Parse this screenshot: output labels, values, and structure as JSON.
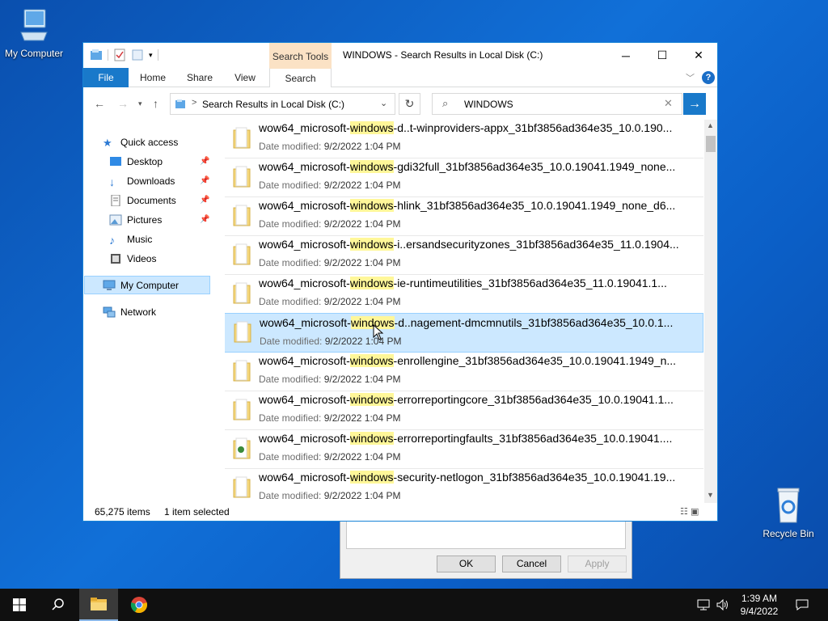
{
  "desktop": {
    "my_computer_label": "My Computer",
    "recycle_bin_label": "Recycle Bin"
  },
  "dialog": {
    "ok_label": "OK",
    "cancel_label": "Cancel",
    "apply_label": "Apply"
  },
  "window": {
    "title": "WINDOWS - Search Results in Local Disk (C:)",
    "contextual_tab_group": "Search Tools",
    "ribbon_tabs": [
      "File",
      "Home",
      "Share",
      "View",
      "Search"
    ],
    "help_label": "?"
  },
  "address": {
    "path": "Search Results in Local Disk (C:)"
  },
  "search": {
    "query": "WINDOWS"
  },
  "nav": {
    "items": [
      {
        "label": "Quick access"
      },
      {
        "label": "Desktop"
      },
      {
        "label": "Downloads"
      },
      {
        "label": "Documents"
      },
      {
        "label": "Pictures"
      },
      {
        "label": "Music"
      },
      {
        "label": "Videos"
      },
      {
        "label": "My Computer"
      },
      {
        "label": "Network"
      }
    ]
  },
  "results": {
    "date_label": "Date modified:",
    "rows": [
      {
        "prefix": "wow64_microsoft-",
        "match": "windows",
        "suffix": "-d..t-winproviders-appx_31bf3856ad364e35_10.0.190...",
        "date": "9/2/2022 1:04 PM"
      },
      {
        "prefix": "wow64_microsoft-",
        "match": "windows",
        "suffix": "-gdi32full_31bf3856ad364e35_10.0.19041.1949_none...",
        "date": "9/2/2022 1:04 PM"
      },
      {
        "prefix": "wow64_microsoft-",
        "match": "windows",
        "suffix": "-hlink_31bf3856ad364e35_10.0.19041.1949_none_d6...",
        "date": "9/2/2022 1:04 PM"
      },
      {
        "prefix": "wow64_microsoft-",
        "match": "windows",
        "suffix": "-i..ersandsecurityzones_31bf3856ad364e35_11.0.1904...",
        "date": "9/2/2022 1:04 PM"
      },
      {
        "prefix": "wow64_microsoft-",
        "match": "windows",
        "suffix": "-ie-runtimeutilities_31bf3856ad364e35_11.0.19041.1...",
        "date": "9/2/2022 1:04 PM"
      },
      {
        "prefix": "wow64_microsoft-",
        "match": "windows",
        "suffix": "-d..nagement-dmcmnutils_31bf3856ad364e35_10.0.1...",
        "date": "9/2/2022 1:04 PM"
      },
      {
        "prefix": "wow64_microsoft-",
        "match": "windows",
        "suffix": "-enrollengine_31bf3856ad364e35_10.0.19041.1949_n...",
        "date": "9/2/2022 1:04 PM"
      },
      {
        "prefix": "wow64_microsoft-",
        "match": "windows",
        "suffix": "-errorreportingcore_31bf3856ad364e35_10.0.19041.1...",
        "date": "9/2/2022 1:04 PM"
      },
      {
        "prefix": "wow64_microsoft-",
        "match": "windows",
        "suffix": "-errorreportingfaults_31bf3856ad364e35_10.0.19041....",
        "date": "9/2/2022 1:04 PM"
      },
      {
        "prefix": "wow64_microsoft-",
        "match": "windows",
        "suffix": "-security-netlogon_31bf3856ad364e35_10.0.19041.19...",
        "date": "9/2/2022 1:04 PM"
      }
    ]
  },
  "status": {
    "item_count": "65,275 items",
    "selection": "1 item selected"
  },
  "taskbar": {
    "time": "1:39 AM",
    "date": "9/4/2022"
  },
  "colors": {
    "accent": "#1979ca",
    "selection": "#cce8ff",
    "highlight": "#fff799",
    "contextual_tab": "#fbe2c5"
  }
}
